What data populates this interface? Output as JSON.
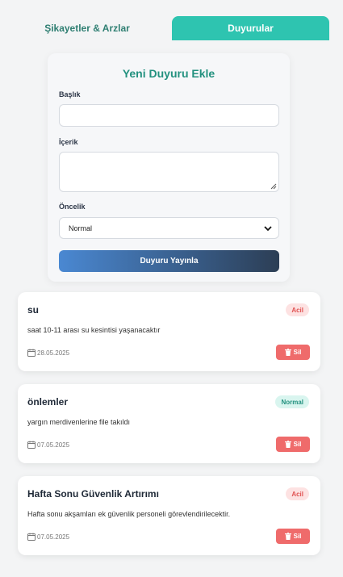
{
  "tabs": [
    {
      "label": "Şikayetler & Arzlar",
      "active": false
    },
    {
      "label": "Duyurular",
      "active": true
    }
  ],
  "form": {
    "title": "Yeni Duyuru Ekle",
    "title_label": "Başlık",
    "title_value": "",
    "content_label": "İçerik",
    "content_value": "",
    "priority_label": "Öncelik",
    "priority_value": "Normal",
    "submit_label": "Duyuru Yayınla"
  },
  "announcements": [
    {
      "title": "su",
      "badge": "Acil",
      "body": "saat 10-11 arası su kesintisi yaşanacaktır",
      "date": "28.05.2025",
      "delete_label": "Sil"
    },
    {
      "title": "önlemler",
      "badge": "Normal",
      "body": "yargın merdivenlerine file takıldı",
      "date": "07.05.2025",
      "delete_label": "Sil"
    },
    {
      "title": "Hafta Sonu Güvenlik Artırımı",
      "badge": "Acil",
      "body": "Hafta sonu akşamları ek güvenlik personeli görevlendirilecektir.",
      "date": "07.05.2025",
      "delete_label": "Sil"
    }
  ],
  "colors": {
    "accent": "#2ec4b0",
    "heading": "#23917f",
    "danger": "#ef6b6b"
  }
}
